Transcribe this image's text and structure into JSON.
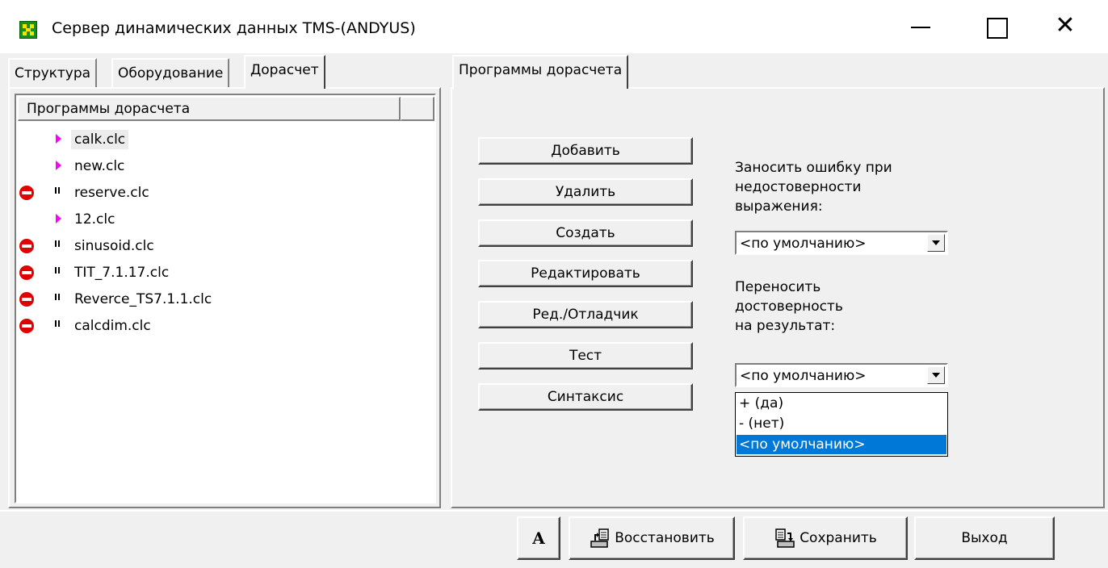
{
  "window": {
    "title": "Сервер динамических данных TMS-(ANDYUS)",
    "icon": "app-grid-icon",
    "controls": [
      "minimize-icon",
      "maximize-icon",
      "close-icon"
    ],
    "close_glyph": "✕"
  },
  "left_tabs": [
    {
      "label": "Структура",
      "active": false
    },
    {
      "label": "Оборудование",
      "active": false
    },
    {
      "label": "Дорасчет",
      "active": true
    }
  ],
  "program_list": {
    "header": "Программы дорасчета",
    "items": [
      {
        "name": "calk.clc",
        "status": "running",
        "selected": true
      },
      {
        "name": "new.clc",
        "status": "running",
        "selected": false
      },
      {
        "name": "reserve.clc",
        "status": "stopped",
        "selected": false
      },
      {
        "name": "12.clc",
        "status": "running",
        "selected": false
      },
      {
        "name": "sinusoid.clc",
        "status": "stopped",
        "selected": false
      },
      {
        "name": "TIT_7.1.17.clc",
        "status": "stopped",
        "selected": false
      },
      {
        "name": "Reverce_TS7.1.1.clc",
        "status": "stopped",
        "selected": false
      },
      {
        "name": "calcdim.clc",
        "status": "stopped",
        "selected": false
      }
    ]
  },
  "right_tab": {
    "label": "Программы дорасчета"
  },
  "actions": {
    "add": "Добавить",
    "delete": "Удалить",
    "create": "Создать",
    "edit": "Редактировать",
    "edit_debug": "Ред./Отладчик",
    "test": "Тест",
    "syntax": "Синтаксис"
  },
  "error_option": {
    "label": "Заносить ошибку при\nнедостоверности\nвыражения:",
    "value": "<по умолчанию>"
  },
  "validity_option": {
    "label": "Переносить\nдостоверность\nна результат:",
    "value": "<по умолчанию>",
    "options": [
      "+ (да)",
      "-  (нет)",
      "<по умолчанию>"
    ],
    "selected_index": 2
  },
  "bottom": {
    "font_button": "A",
    "restore": "Восстановить",
    "save": "Сохранить",
    "exit": "Выход"
  },
  "colors": {
    "running": "#ff00ff",
    "stopped": "#e00000",
    "selection": "#0078d7"
  }
}
